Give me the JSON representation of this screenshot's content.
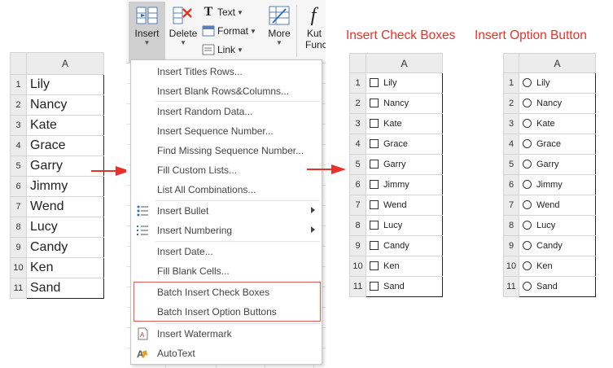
{
  "ribbon": {
    "insert_label": "Insert",
    "delete_label": "Delete",
    "text_label": "Text",
    "format_label": "Format",
    "link_label": "Link",
    "more_label": "More",
    "kutools_label_1": "Kut",
    "kutools_label_2": "Func"
  },
  "left_sheet": {
    "column": "A",
    "rows": [
      {
        "num": "1",
        "value": "Lily"
      },
      {
        "num": "2",
        "value": "Nancy"
      },
      {
        "num": "3",
        "value": "Kate"
      },
      {
        "num": "4",
        "value": "Grace"
      },
      {
        "num": "5",
        "value": "Garry"
      },
      {
        "num": "6",
        "value": "Jimmy"
      },
      {
        "num": "7",
        "value": "Wend"
      },
      {
        "num": "8",
        "value": "Lucy"
      },
      {
        "num": "9",
        "value": "Candy"
      },
      {
        "num": "10",
        "value": "Ken"
      },
      {
        "num": "11",
        "value": "Sand"
      }
    ]
  },
  "menu": {
    "items": [
      "Insert Titles Rows...",
      "Insert Blank Rows&Columns...",
      "Insert Random Data...",
      "Insert Sequence Number...",
      "Find Missing Sequence Number...",
      "Fill Custom Lists...",
      "List All Combinations...",
      "Insert Bullet",
      "Insert Numbering",
      "Insert Date...",
      "Fill Blank Cells...",
      "Batch Insert Check Boxes",
      "Batch Insert Option Buttons",
      "Insert Watermark",
      "AutoText"
    ]
  },
  "checkbox_sheet": {
    "caption": "Insert Check Boxes",
    "column": "A",
    "rows": [
      {
        "num": "1",
        "value": "Lily"
      },
      {
        "num": "2",
        "value": "Nancy"
      },
      {
        "num": "3",
        "value": "Kate"
      },
      {
        "num": "4",
        "value": "Grace"
      },
      {
        "num": "5",
        "value": "Garry"
      },
      {
        "num": "6",
        "value": "Jimmy"
      },
      {
        "num": "7",
        "value": "Wend"
      },
      {
        "num": "8",
        "value": "Lucy"
      },
      {
        "num": "9",
        "value": "Candy"
      },
      {
        "num": "10",
        "value": "Ken"
      },
      {
        "num": "11",
        "value": "Sand"
      }
    ]
  },
  "option_sheet": {
    "caption": "Insert Option Button",
    "column": "A",
    "rows": [
      {
        "num": "1",
        "value": "Lily"
      },
      {
        "num": "2",
        "value": "Nancy"
      },
      {
        "num": "3",
        "value": "Kate"
      },
      {
        "num": "4",
        "value": "Grace"
      },
      {
        "num": "5",
        "value": "Garry"
      },
      {
        "num": "6",
        "value": "Jimmy"
      },
      {
        "num": "7",
        "value": "Wend"
      },
      {
        "num": "8",
        "value": "Lucy"
      },
      {
        "num": "9",
        "value": "Candy"
      },
      {
        "num": "10",
        "value": "Ken"
      },
      {
        "num": "11",
        "value": "Sand"
      }
    ]
  },
  "colors": {
    "caption_red": "#e8312b",
    "arrow_red": "#e8312b",
    "highlight_border": "#e05a5a",
    "header_gray": "#ececec"
  },
  "icons": {
    "insert": "insert-cells-icon",
    "delete": "delete-cells-icon",
    "text": "text-icon",
    "format": "format-icon",
    "link": "link-icon",
    "more": "more-icon",
    "kutools": "function-icon",
    "bullet": "bullet-list-icon",
    "numbering": "numbered-list-icon",
    "watermark": "watermark-icon",
    "autotext": "autotext-icon",
    "arrow": "right-arrow-icon"
  }
}
